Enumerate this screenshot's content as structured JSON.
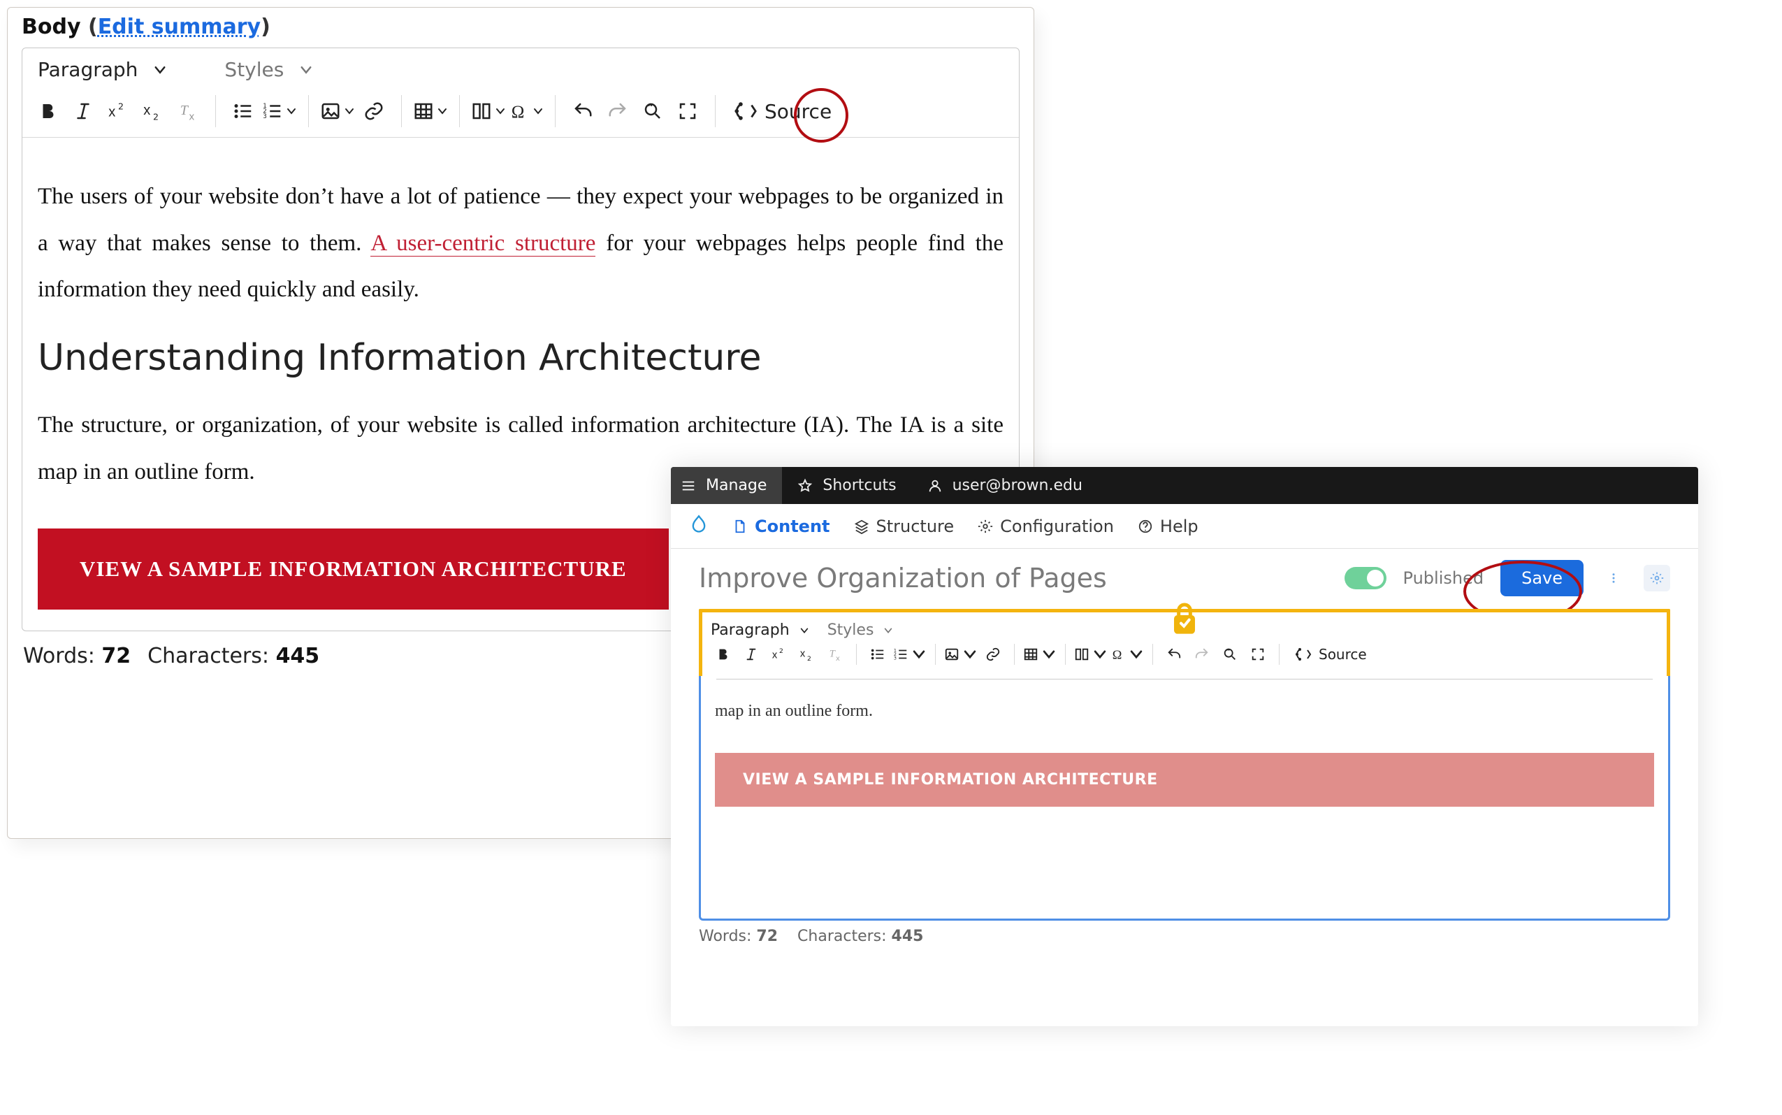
{
  "panelA": {
    "header": {
      "label": "Body",
      "edit_summary_label": "Edit summary"
    },
    "toolbar": {
      "paragraph_label": "Paragraph",
      "styles_label": "Styles",
      "source_label": "Source"
    },
    "content": {
      "body_pre": "The users of your website don’t have a lot of patience — they expect your webpages to be orga­nized in a way that makes sense to them. ",
      "body_link": "A user-centric structure",
      "body_post": " for your webpages helps people find the information they need quickly and easily.",
      "heading": "Understanding Information Architecture",
      "body2": "The structure, or organization, of your website is called information architecture (IA). The IA is a site map in an outline form.",
      "cta_label": "VIEW A SAMPLE INFORMATION ARCHITECTURE"
    },
    "footer": {
      "words_label": "Words:",
      "words_value": "72",
      "chars_label": "Characters:",
      "chars_value": "445"
    }
  },
  "panelB": {
    "adminbar": {
      "manage": "Manage",
      "shortcuts": "Shortcuts",
      "user": "user@brown.edu"
    },
    "nav": {
      "content": "Content",
      "structure": "Structure",
      "configuration": "Configuration",
      "help": "Help"
    },
    "header": {
      "title": "Improve Organization of Pages",
      "published": "Published",
      "save": "Save"
    },
    "toolbar": {
      "paragraph_label": "Paragraph",
      "styles_label": "Styles",
      "source_label": "Source"
    },
    "body": {
      "clipped_text": "map in an outline form.",
      "cta_label": "VIEW A SAMPLE INFORMATION ARCHITECTURE"
    },
    "footer": {
      "words_label": "Words:",
      "words_value": "72",
      "chars_label": "Characters:",
      "chars_value": "445"
    }
  }
}
